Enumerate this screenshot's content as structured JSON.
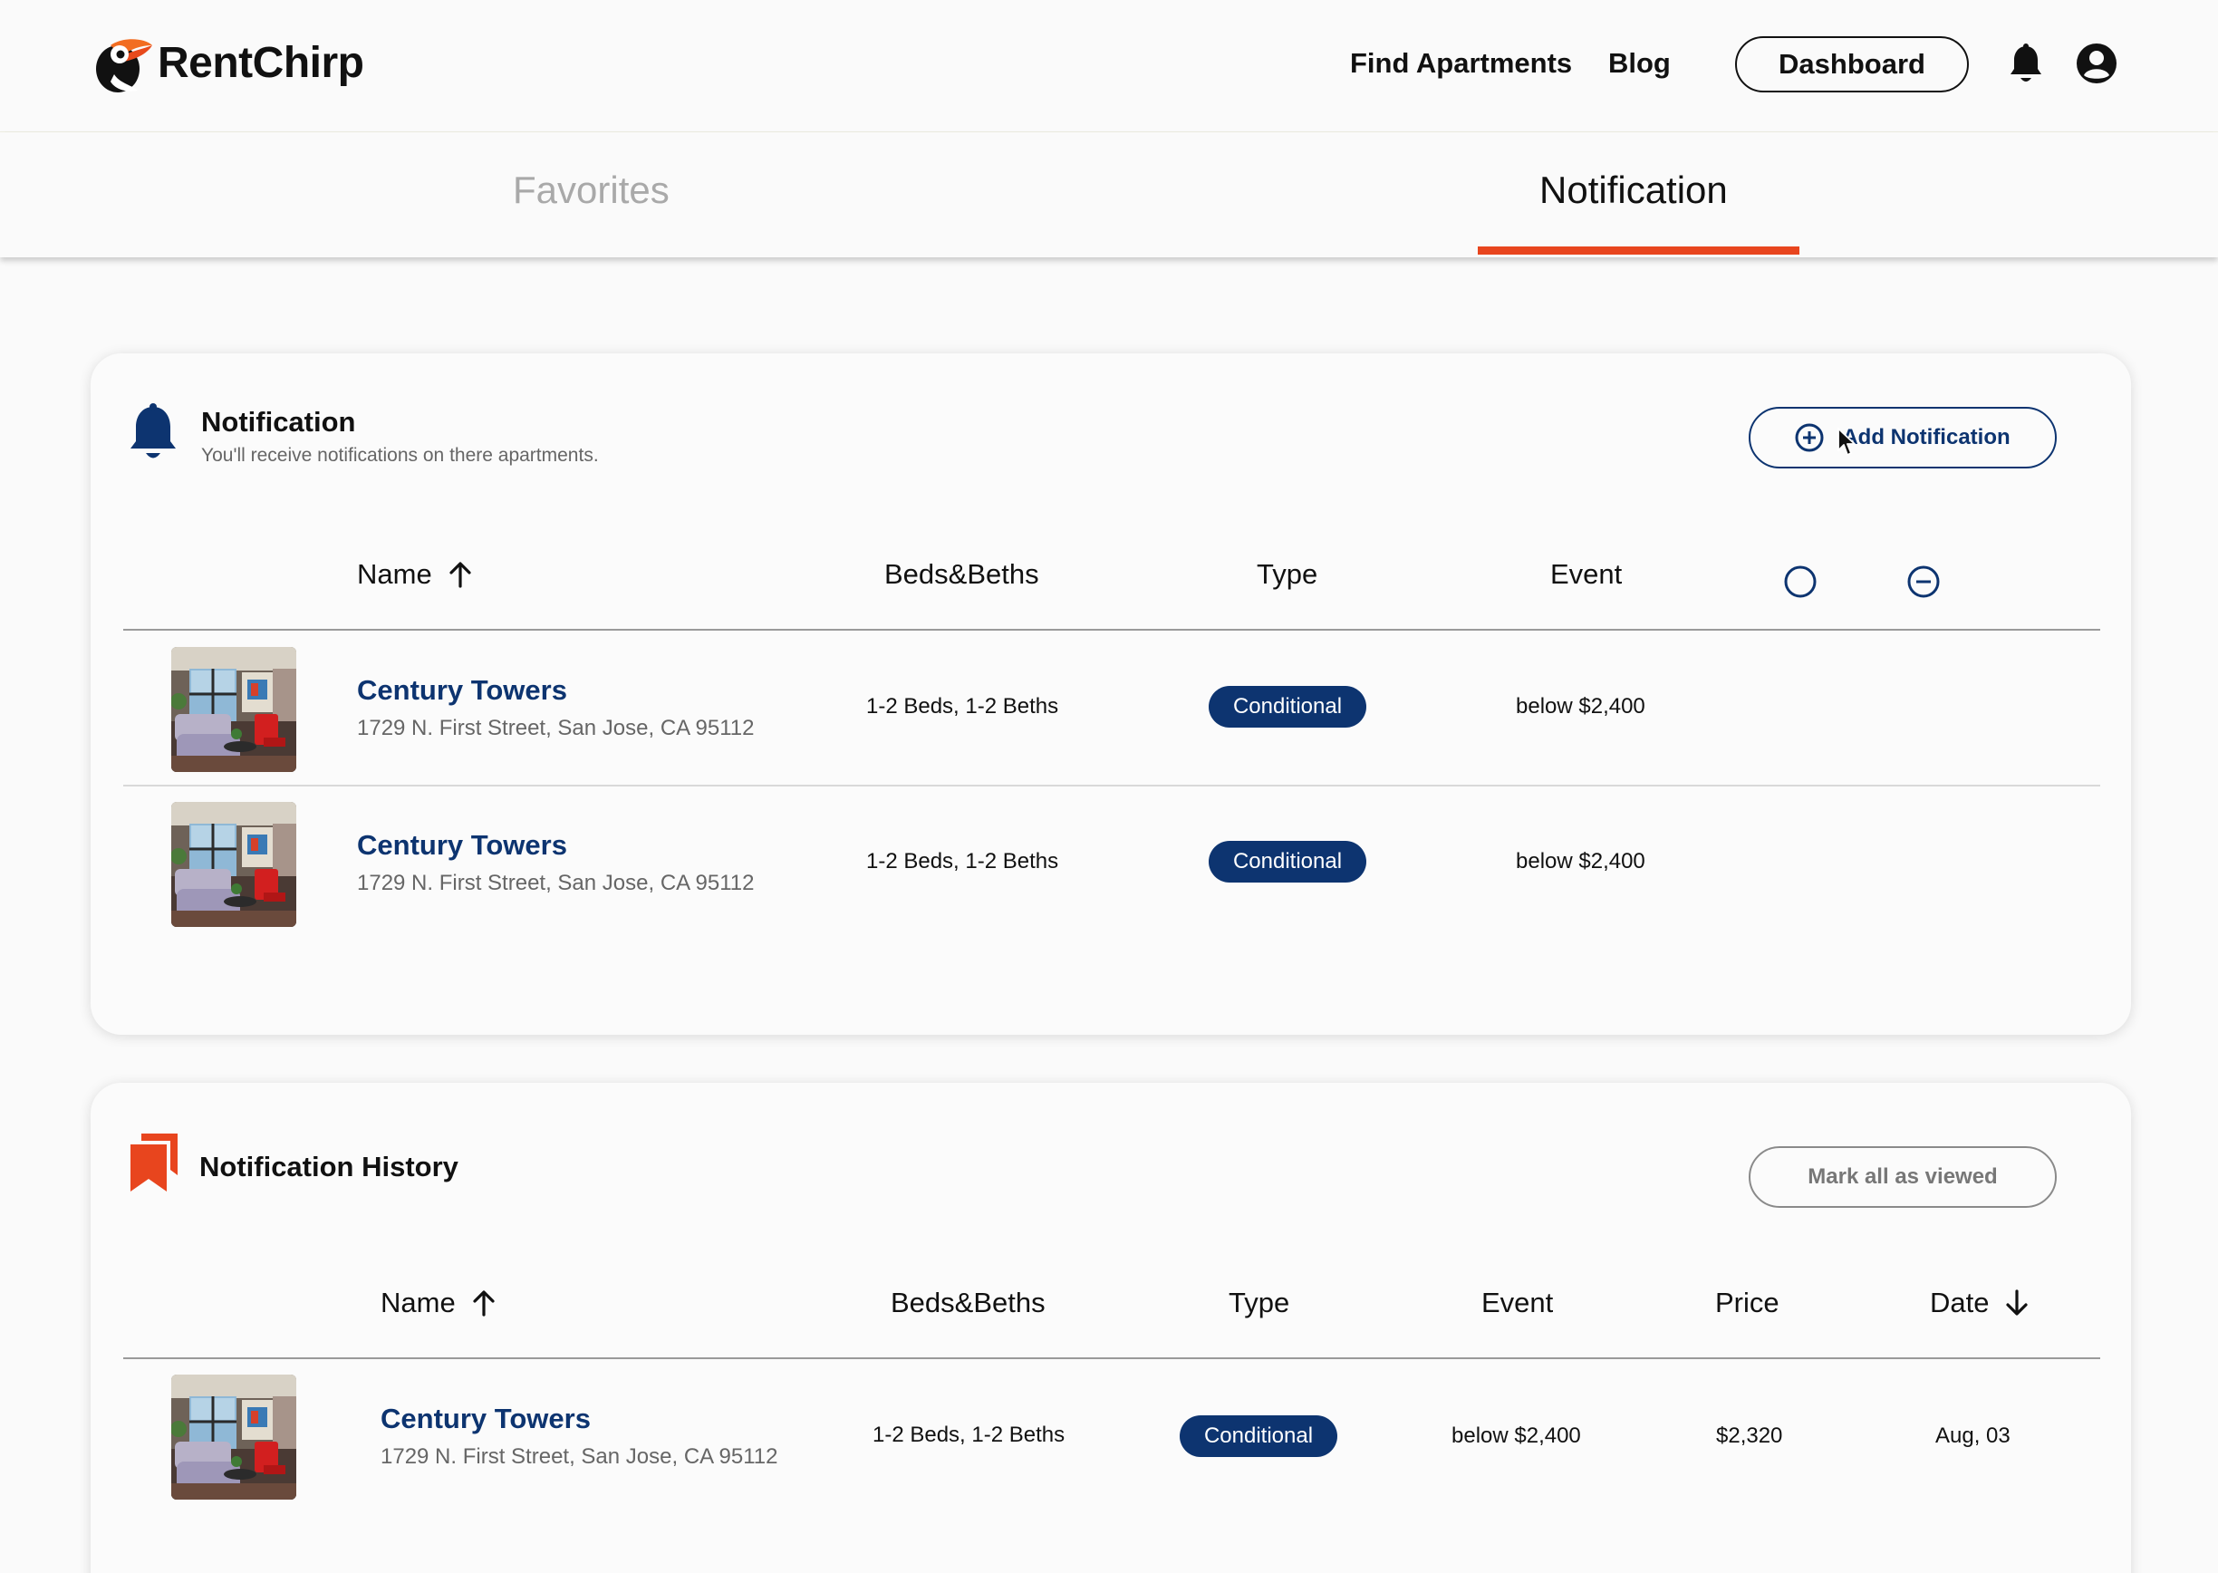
{
  "header": {
    "brand": "RentChirp",
    "nav": [
      "Find Apartments",
      "Blog"
    ],
    "dashboard_label": "Dashboard",
    "icons": [
      "toucan-logo",
      "bell-icon",
      "account-circle-icon"
    ]
  },
  "tabs": {
    "favorites": "Favorites",
    "notification": "Notification",
    "active": "Notification",
    "active_color": "#e8451e"
  },
  "notification_card": {
    "title": "Notification",
    "subtitle": "You'll receive notifications on there apartments.",
    "add_label": "Add Notification",
    "columns": {
      "name": "Name",
      "beds": "Beds&Beths",
      "type": "Type",
      "event": "Event"
    },
    "rows": [
      {
        "name": "Century Towers",
        "address": "1729 N. First Street, San Jose, CA 95112",
        "beds": "1-2 Beds, 1-2 Beths",
        "type": "Conditional",
        "event": "below $2,400"
      },
      {
        "name": "Century Towers",
        "address": "1729 N. First Street, San Jose, CA 95112",
        "beds": "1-2 Beds, 1-2 Beths",
        "type": "Conditional",
        "event": "below $2,400"
      }
    ]
  },
  "history_card": {
    "title": "Notification History",
    "mark_label": "Mark all as viewed",
    "columns": {
      "name": "Name",
      "beds": "Beds&Beths",
      "type": "Type",
      "event": "Event",
      "price": "Price",
      "date": "Date"
    },
    "rows": [
      {
        "name": "Century Towers",
        "address": "1729 N. First Street, San Jose, CA 95112",
        "beds": "1-2 Beds, 1-2 Beths",
        "type": "Conditional",
        "event": "below $2,400",
        "price": "$2,320",
        "date": "Aug, 03"
      }
    ]
  },
  "colors": {
    "primary": "#0d3470",
    "accent": "#e8451e"
  }
}
